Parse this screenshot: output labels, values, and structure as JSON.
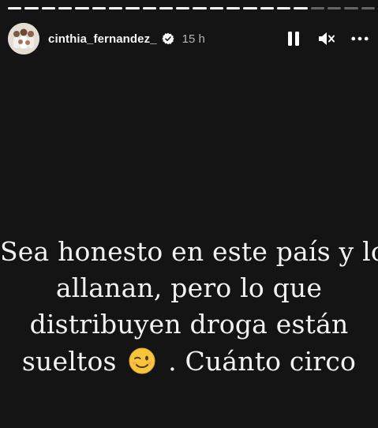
{
  "story": {
    "progress": [
      1,
      1,
      1,
      1,
      1,
      1,
      1,
      1,
      1,
      1,
      1,
      1,
      1,
      1,
      1,
      1,
      1,
      1,
      0,
      0,
      0,
      0
    ],
    "user": {
      "username": "cinthia_fernandez_",
      "time": "15 h"
    },
    "controls": {
      "pause_icon": "pause-icon",
      "mute_icon": "mute-icon",
      "more_icon": "more-icon"
    },
    "caption": {
      "line1": "Sea honesto en este país y lo",
      "line2": "allanan, pero lo que",
      "line3": "distribuyen droga están",
      "line4a": "sueltos",
      "line4_emoji": "😉",
      "line4b": ". Cuánto circo"
    },
    "colors": {
      "background": "#141414",
      "text": "#f2f2f2",
      "verified": "#ffffff",
      "emoji_face": "#f7c53a"
    }
  }
}
